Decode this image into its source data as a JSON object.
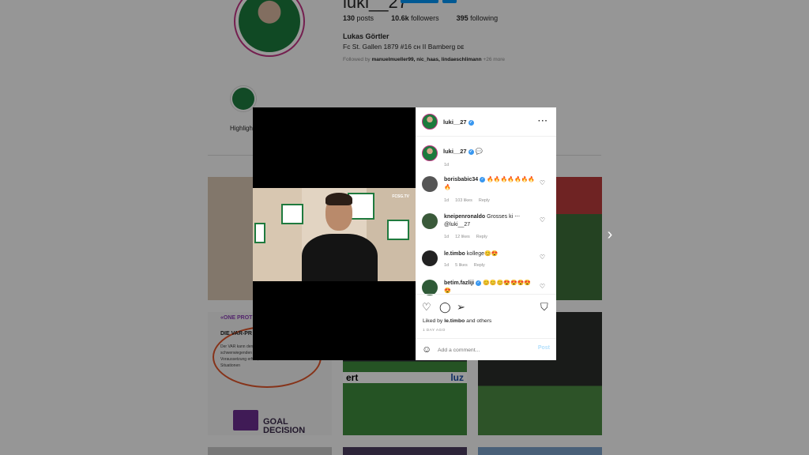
{
  "profile": {
    "username": "luki__27",
    "stats": {
      "posts": "130",
      "posts_label": "posts",
      "followers": "10.6k",
      "followers_label": "followers",
      "following": "395",
      "following_label": "following"
    },
    "full_name": "Lukas Görtler",
    "bio": "Fc St. Gallen 1879 #16 ᴄʜ II Bamberg ᴅᴇ",
    "followed_by_prefix": "Followed by",
    "followed_by_names": "manuelmueller99, nic_haas, lindaeschlimann",
    "followed_by_more": "+26 more",
    "highlight_label": "Highlights"
  },
  "grid": {
    "tile4_title": "«ONE PROT",
    "tile4_subtitle": "DIE VAR-PR",
    "tile4_text": "Der VAR kann den klaren und offen oder wenn der S schwerwiegenden Vorfall übersehen hat. Ist diese Voraussetzung erfüllt, darf der VAR ausschliesslich am Situationen",
    "tile4_brand": "GOAL DECISION",
    "tile5_ad_left": "ert",
    "tile5_ad_right": "luz",
    "video_tag": "FCSG.TV"
  },
  "modal": {
    "header_username": "luki__27",
    "caption_username": "luki__27",
    "caption_time": "1d",
    "comments": [
      {
        "user": "borisbabic34",
        "verified": true,
        "text": "🔥🔥🔥🔥🔥🔥🔥🔥",
        "time": "1d",
        "likes": "103 likes",
        "reply": "Reply"
      },
      {
        "user": "kneipenronaldo",
        "verified": false,
        "text": "Grosses ki ⋯ @luki__27",
        "time": "1d",
        "likes": "12 likes",
        "reply": "Reply"
      },
      {
        "user": "le.timbo",
        "verified": false,
        "text": "kollege😊😍",
        "time": "1d",
        "likes": "5 likes",
        "reply": "Reply"
      },
      {
        "user": "betim.fazliji",
        "verified": true,
        "text": "😊😊😊😍😍😍😍😍",
        "time": "",
        "likes": "",
        "reply": ""
      }
    ],
    "liked_by_prefix": "Liked by",
    "liked_by_user": "le.timbo",
    "liked_by_suffix": "and others",
    "posted_ago": "1 DAY AGO",
    "add_comment_placeholder": "Add a comment...",
    "post_label": "Post"
  },
  "icons": {
    "heart": "heart-icon",
    "comment": "comment-icon",
    "share": "share-icon",
    "save": "bookmark-icon",
    "emoji": "emoji-icon",
    "more": "more-icon",
    "next": "chevron-right-icon"
  },
  "colors": {
    "accent": "#0095f6",
    "verified": "#3897f0",
    "story_ring": "#c13584",
    "overlay": "rgba(0,0,0,0.4)"
  }
}
